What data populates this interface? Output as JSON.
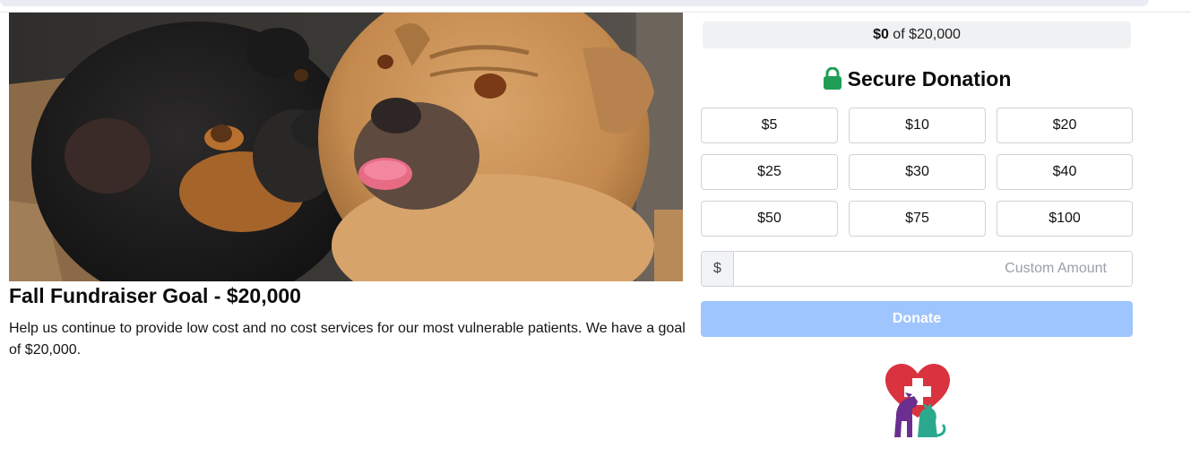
{
  "fundraiser": {
    "photo_alt": "Two dogs, a black-and-tan dog and a fawn dog with tongue out",
    "title": "Fall Fundraiser Goal - $20,000",
    "description": "Help us continue to provide low cost and no cost services for our most vulnerable patients. We have a goal of $20,000."
  },
  "donation": {
    "raised": "$0",
    "goal_text": " of $20,000",
    "progress_fraction": 0,
    "secure_title": "Secure Donation",
    "lock_icon": "lock-icon",
    "amounts": [
      "$5",
      "$10",
      "$20",
      "$25",
      "$30",
      "$40",
      "$50",
      "$75",
      "$100"
    ],
    "currency_prefix": "$",
    "custom_placeholder": "Custom Amount",
    "donate_label": "Donate"
  },
  "colors": {
    "lock_green": "#1f9d55",
    "donate_disabled_blue": "#9ec5fe",
    "logo_heart_red": "#d9333f",
    "logo_purple": "#6a2f8f",
    "logo_teal": "#2ba98f"
  }
}
